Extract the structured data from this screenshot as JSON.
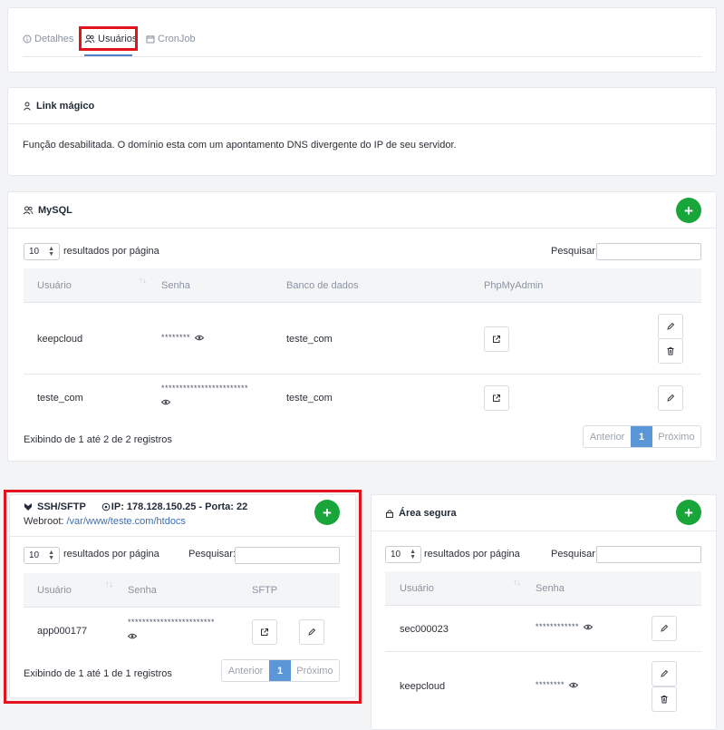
{
  "tabs": {
    "details": "Detalhes",
    "users": "Usuários",
    "cronjob": "CronJob"
  },
  "magic_link": {
    "title": "Link mágico",
    "message": "Função desabilitada. O domínio esta com um apontamento DNS divergente do IP de seu servidor."
  },
  "mysql": {
    "title": "MySQL",
    "page_length": "10",
    "per_page_label": "resultados por página",
    "search_label": "Pesquisar:",
    "columns": [
      "Usuário",
      "Senha",
      "Banco de dados",
      "PhpMyAdmin"
    ],
    "rows": [
      {
        "user": "keepcloud",
        "password": "********",
        "database": "teste_com"
      },
      {
        "user": "teste_com",
        "password": "************************",
        "database": "teste_com"
      }
    ],
    "info": "Exibindo de 1 até 2 de 2 registros",
    "pager": {
      "prev": "Anterior",
      "current": "1",
      "next": "Próximo"
    }
  },
  "ssh": {
    "title": "SSH/SFTP",
    "ip_info": "IP: 178.128.150.25 - Porta: 22",
    "webroot_label": "Webroot:",
    "webroot_path": "/var/www/teste.com/htdocs",
    "page_length": "10",
    "per_page_label": "resultados por página",
    "search_label": "Pesquisar:",
    "columns": [
      "Usuário",
      "Senha",
      "SFTP"
    ],
    "rows": [
      {
        "user": "app000177",
        "password": "************************"
      }
    ],
    "info": "Exibindo de 1 até 1 de 1 registros",
    "pager": {
      "prev": "Anterior",
      "current": "1",
      "next": "Próximo"
    }
  },
  "secure": {
    "title": "Área segura",
    "page_length": "10",
    "per_page_label": "resultados por página",
    "search_label": "Pesquisar:",
    "columns": [
      "Usuário",
      "Senha"
    ],
    "rows": [
      {
        "user": "sec000023",
        "password": "************"
      },
      {
        "user": "keepcloud",
        "password": "********"
      }
    ]
  },
  "colors": {
    "add_button": "#18a53a",
    "highlight": "#e3121c",
    "pager_active": "#5b97d8",
    "link": "#3b6fb6"
  }
}
